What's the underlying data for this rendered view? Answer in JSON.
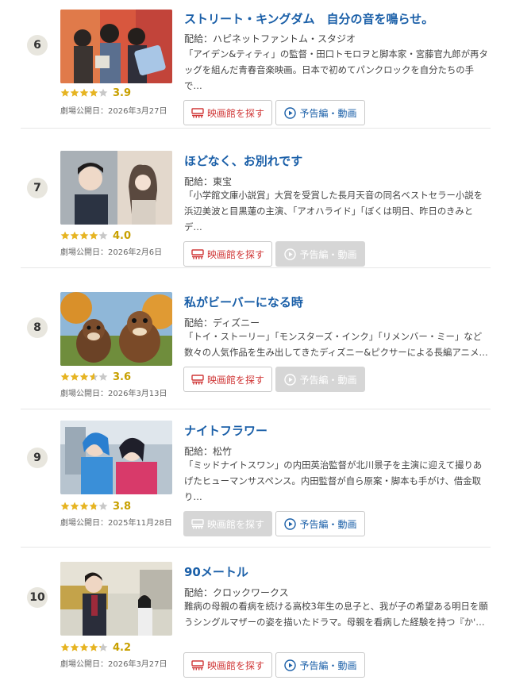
{
  "movies": [
    {
      "rank": "6",
      "title": "ストリート・キングダム　自分の音を鳴らせ。",
      "distributor": "配給：ハピネットファントム・スタジオ",
      "description": "「アイデン&ティティ」の監督・田口トモロヲと脚本家・宮藤官九郎が再タッグを組んだ青春音楽映画。日本で初めてパンクロックを自分たちの手で…",
      "rating": 3.9,
      "score": "3.9",
      "release": "劇場公開日：2026年3月27日",
      "theater_label": "映画館を探す",
      "trailer_label": "予告編・動画",
      "theater_enabled": true,
      "trailer_enabled": true
    },
    {
      "rank": "7",
      "title": "ほどなく、お別れです",
      "distributor": "配給：東宝",
      "description": "「小学館文庫小説賞」大賞を受賞した長月天音の同名ベストセラー小説を浜辺美波と目黒蓮の主演、「アオハライド」「ぼくは明日、昨日のきみとデ…",
      "rating": 4.0,
      "score": "4.0",
      "release": "劇場公開日：2026年2月6日",
      "theater_label": "映画館を探す",
      "trailer_label": "予告編・動画",
      "theater_enabled": true,
      "trailer_enabled": false
    },
    {
      "rank": "8",
      "title": "私がビーバーになる時",
      "distributor": "配給：ディズニー",
      "description": "「トイ・ストーリー」「モンスターズ・インク」「リメンバー・ミー」など数々の人気作品を生み出してきたディズニー&ピクサーによる長編アニメ…",
      "rating": 3.6,
      "score": "3.6",
      "release": "劇場公開日：2026年3月13日",
      "theater_label": "映画館を探す",
      "trailer_label": "予告編・動画",
      "theater_enabled": true,
      "trailer_enabled": false
    },
    {
      "rank": "9",
      "title": "ナイトフラワー",
      "distributor": "配給：松竹",
      "description": "「ミッドナイトスワン」の内田英治監督が北川景子を主演に迎えて撮りあげたヒューマンサスペンス。内田監督が自ら原案・脚本も手がけ、借金取り…",
      "rating": 3.8,
      "score": "3.8",
      "release": "劇場公開日：2025年11月28日",
      "theater_label": "映画館を探す",
      "trailer_label": "予告編・動画",
      "theater_enabled": false,
      "trailer_enabled": true
    },
    {
      "rank": "10",
      "title": "90メートル",
      "distributor": "配給：クロックワークス",
      "description": "難病の母親の看病を続ける高校3年生の息子と、我が子の希望ある明日を願うシングルマザーの姿を描いたドラマ。母親を看病した経験を持つ『か'…",
      "rating": 4.2,
      "score": "4.2",
      "release": "劇場公開日：2026年3月27日",
      "theater_label": "映画館を探す",
      "trailer_label": "予告編・動画",
      "theater_enabled": true,
      "trailer_enabled": true
    }
  ],
  "colors": {
    "title": "#1a5fa8",
    "star": "#e6b422",
    "star_empty": "#c8c8c8",
    "theater": "#d03838",
    "disabled": "#d6d6d6"
  },
  "icons": {
    "theater": "cinema-seat-icon",
    "trailer": "play-circle-icon",
    "star": "star-icon"
  }
}
